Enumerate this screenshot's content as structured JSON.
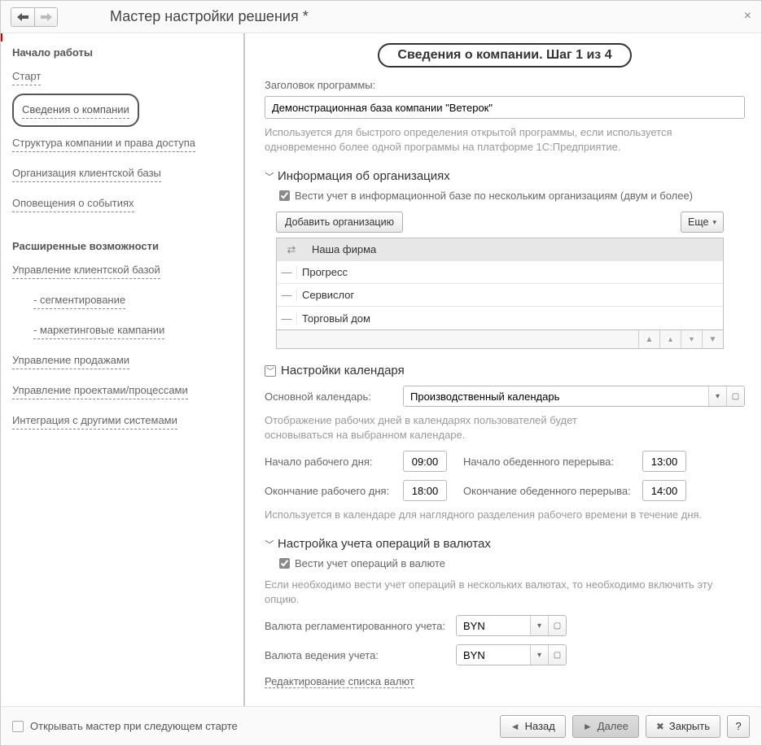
{
  "window": {
    "title": "Мастер настройки решения *",
    "close_label": "×"
  },
  "sidebar": {
    "group1_title": "Начало работы",
    "group1_items": [
      {
        "label": "Старт"
      },
      {
        "label": "Сведения о компании",
        "active": true
      },
      {
        "label": "Структура компании и права доступа"
      },
      {
        "label": "Организация клиентской базы"
      },
      {
        "label": "Оповещения о событиях"
      }
    ],
    "group2_title": "Расширенные возможности",
    "group2_items": [
      {
        "label": "Управление клиентской базой"
      },
      {
        "label": "- сегментирование",
        "sub": true
      },
      {
        "label": "- маркетинговые кампании",
        "sub": true
      },
      {
        "label": "Управление продажами"
      },
      {
        "label": "Управление проектами/процессами"
      },
      {
        "label": "Интеграция с другими системами"
      }
    ]
  },
  "heading": "Сведения о компании. Шаг 1 из 4",
  "program_title_label": "Заголовок программы:",
  "program_title_value": "Демонстрационная база компании \"Ветерок\"",
  "program_title_hint": "Используется для быстрого определения открытой программы, если используется одновременно более одной программы на платформе 1С:Предприятие.",
  "orgs": {
    "section_title": "Информация об организациях",
    "multi_org_label": "Вести учет в информационной базе по нескольким организациям (двум и более)",
    "add_btn": "Добавить организацию",
    "more_btn": "Еще",
    "items": [
      {
        "name": "Наша фирма",
        "primary": true
      },
      {
        "name": "Прогресс"
      },
      {
        "name": "Сервислог"
      },
      {
        "name": "Торговый дом"
      }
    ]
  },
  "calendar": {
    "section_title": "Настройки календаря",
    "main_label": "Основной календарь:",
    "main_value": "Производственный календарь",
    "hint": "Отображение рабочих дней в календарях пользователей будет основываться на выбранном календаре.",
    "work_start_label": "Начало рабочего дня:",
    "work_start_value": "09:00",
    "lunch_start_label": "Начало обеденного перерыва:",
    "lunch_start_value": "13:00",
    "work_end_label": "Окончание рабочего дня:",
    "work_end_value": "18:00",
    "lunch_end_label": "Окончание обеденного перерыва:",
    "lunch_end_value": "14:00",
    "footnote": "Используется в календаре для наглядного разделения рабочего времени в течение дня."
  },
  "currency": {
    "section_title": "Настройка учета операций в валютах",
    "enable_label": "Вести учет операций в валюте",
    "hint": "Если необходимо вести учет операций в нескольких валютах, то необходимо включить эту опцию.",
    "reg_label": "Валюта регламентированного учета:",
    "reg_value": "BYN",
    "acc_label": "Валюта ведения учета:",
    "acc_value": "BYN",
    "edit_link": "Редактирование списка валют"
  },
  "footer": {
    "open_next_label": "Открывать мастер при следующем старте",
    "back": "Назад",
    "next": "Далее",
    "close": "Закрыть",
    "help": "?"
  }
}
